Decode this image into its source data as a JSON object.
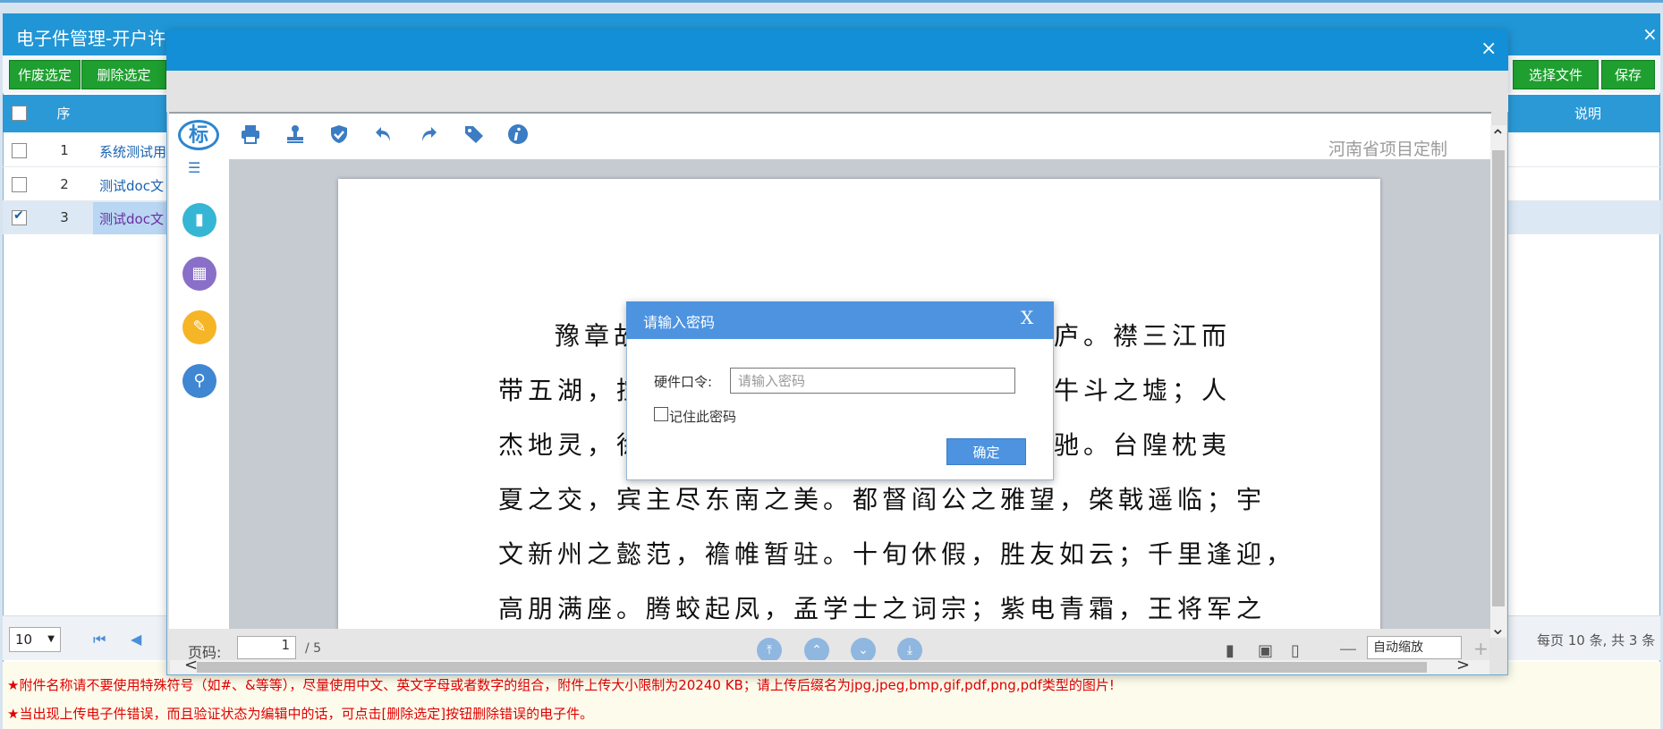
{
  "background_window": {
    "title": "电子件管理-开户许可证",
    "close_symbol": "×",
    "toolbar": {
      "void_label": "作废选定",
      "delete_label": "删除选定",
      "select_file_label": "选择文件",
      "save_label": "保存"
    },
    "table": {
      "headers": {
        "seq": "序",
        "note": "说明"
      },
      "rows": [
        {
          "seq": "1",
          "name": "系统测试用",
          "checked": false
        },
        {
          "seq": "2",
          "name": "测试doc文",
          "checked": false
        },
        {
          "seq": "3",
          "name": "测试doc文",
          "checked": true
        }
      ]
    },
    "pager": {
      "page_size": "10",
      "summary": "每页 10 条, 共 3 条"
    },
    "notices": [
      "★附件名称请不要使用特殊符号（如#、&等等），尽量使用中文、英文字母或者数字的组合，附件上传大小限制为20240 KB；请上传后缀名为jpg,jpeg,bmp,gif,pdf,png,pdf类型的图片!",
      "★当出现上传电子件错误，而且验证状态为编辑中的话，可点击[删除选定]按钮删除错误的电子件。"
    ]
  },
  "viewer": {
    "close_symbol": "×",
    "logo_text": "标",
    "brand_text": "河南省项目定制",
    "toolbar_icons": [
      "print-icon",
      "stamp-icon",
      "shield-check-icon",
      "undo-icon",
      "redo-icon",
      "tag-icon",
      "info-icon"
    ],
    "side_icons": [
      "book-icon",
      "grid-icon",
      "pen-icon",
      "search-icon"
    ],
    "document_lines": [
      "豫章故",
      "庐。襟三江而",
      "带五湖，控",
      "牛斗之墟；人",
      "杰地灵，徐",
      "驰。台隍枕夷",
      "夏之交，宾主尽东南之美。都督阎公之雅望，棨戟遥临；宇",
      "文新州之懿范，襜帷暂驻。十旬休假，胜友如云；千里逢迎，",
      "高朋满座。腾蛟起凤，孟学士之词宗；紫电青霜，王将军之"
    ],
    "statusbar": {
      "page_label": "页码:",
      "current_page": "1",
      "total_pages": "/ 5",
      "zoom_value": "自动缩放",
      "zoom_minus": "—",
      "zoom_plus": "+"
    }
  },
  "password_dialog": {
    "title": "请输入密码",
    "close_label": "X",
    "field_label": "硬件口令:",
    "placeholder": "请输入密码",
    "value": "",
    "remember_label": "记住此密码",
    "remember_checked": false,
    "confirm_label": "确定"
  },
  "colors": {
    "title_blue": "#2196d6",
    "dialog_blue": "#4d93e0",
    "green_button": "#1e9f2f",
    "notice_red": "#e00000"
  }
}
